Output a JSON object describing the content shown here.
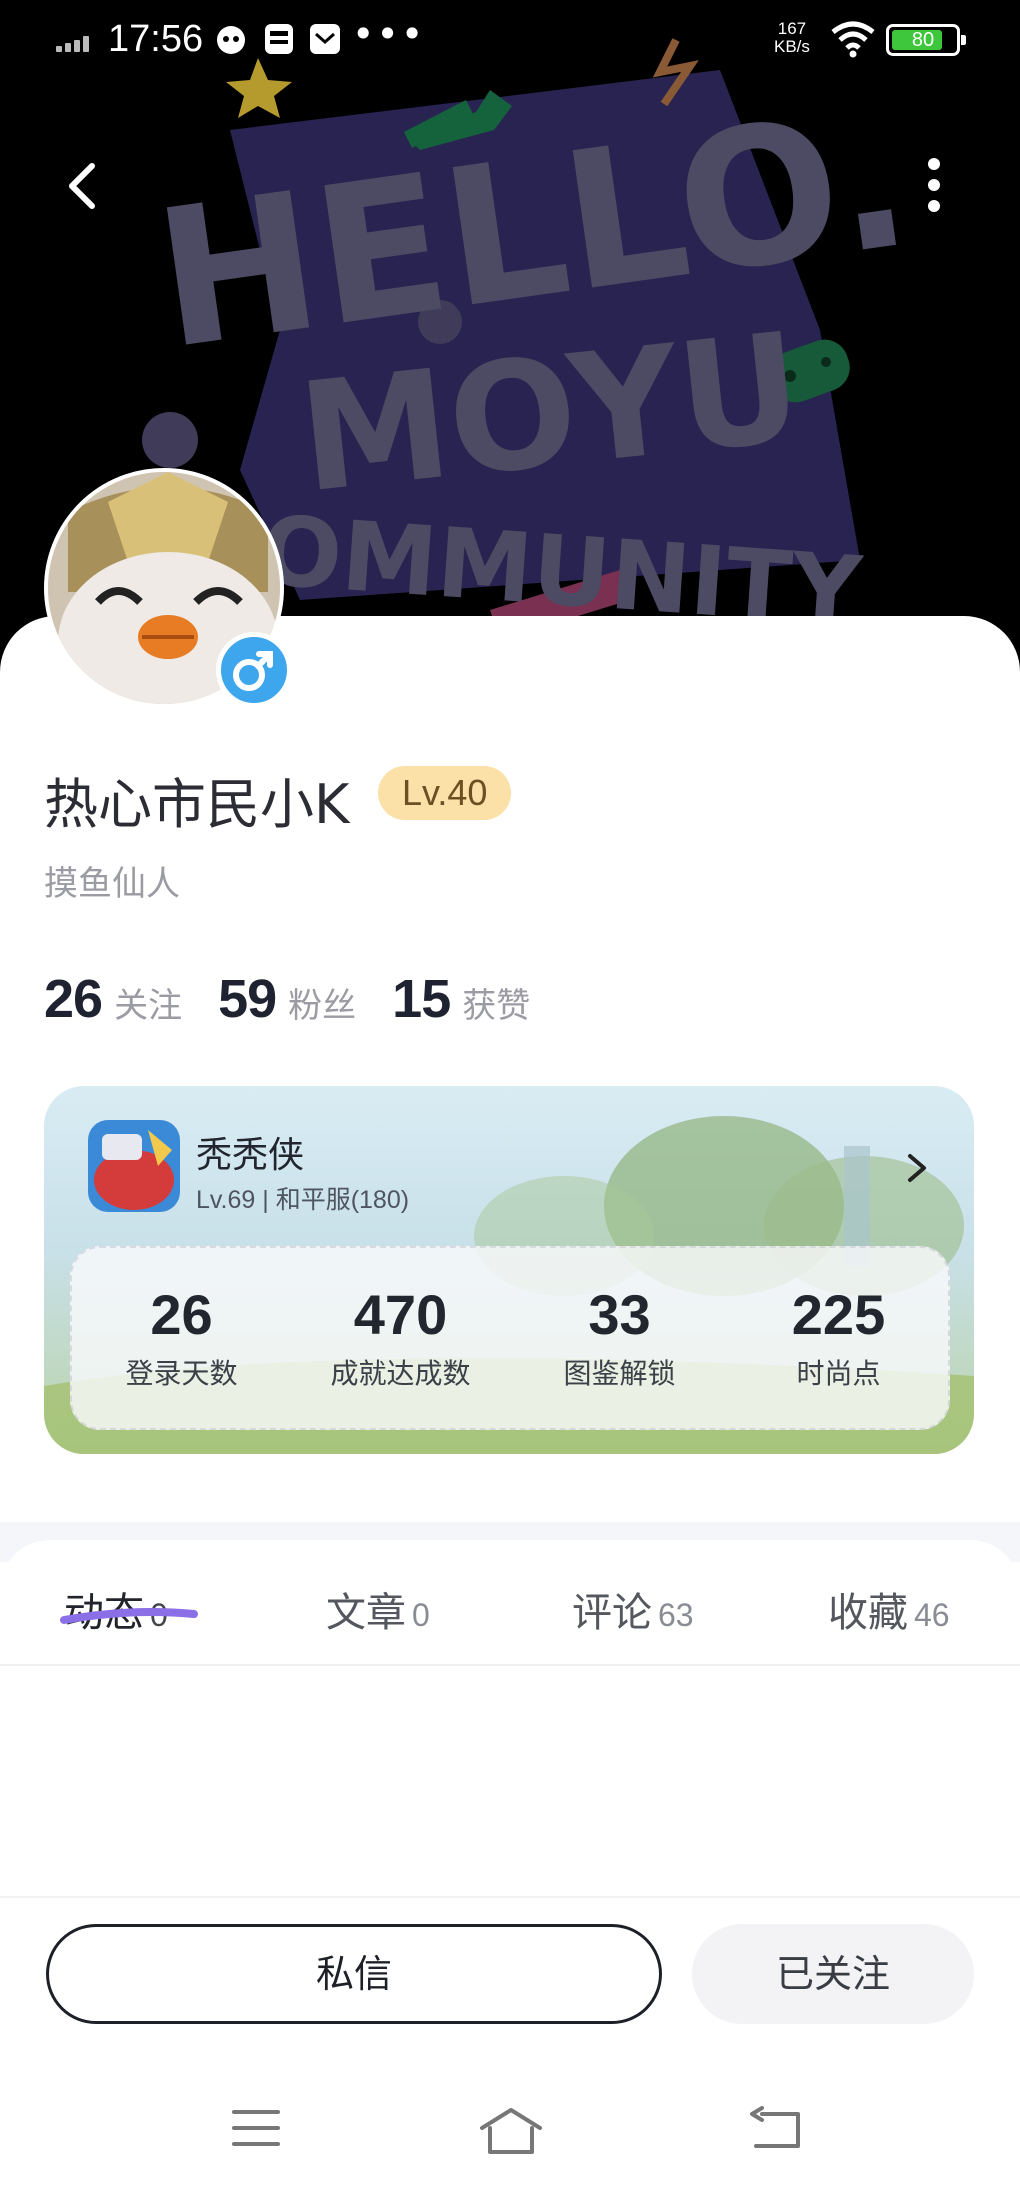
{
  "status_bar": {
    "time": "17:56",
    "net_speed_value": "167",
    "net_speed_unit": "KB/s",
    "battery": "80",
    "battery_level": 0.8,
    "icons": [
      "signal-icon",
      "cat-app-icon",
      "train-app-icon",
      "mail-app-icon",
      "more-dots-icon",
      "wifi-icon",
      "battery-icon"
    ]
  },
  "nav": {
    "back_icon": "chevron-left-icon",
    "more_icon": "vertical-dots-icon"
  },
  "banner": {
    "line1": "HELLO.",
    "line2": "MOYU",
    "line3": "COMMUNITY"
  },
  "profile": {
    "username": "热心市民小K",
    "level": "Lv.40",
    "title": "摸鱼仙人",
    "gender_icon": "male-icon",
    "stats": [
      {
        "value": "26",
        "label": "关注"
      },
      {
        "value": "59",
        "label": "粉丝"
      },
      {
        "value": "15",
        "label": "获赞"
      }
    ]
  },
  "game_card": {
    "name": "秃秃侠",
    "subtitle": "Lv.69 | 和平服(180)",
    "stats": [
      {
        "value": "26",
        "label": "登录天数"
      },
      {
        "value": "470",
        "label": "成就达成数"
      },
      {
        "value": "33",
        "label": "图鉴解锁"
      },
      {
        "value": "225",
        "label": "时尚点"
      }
    ]
  },
  "tabs": [
    {
      "label": "动态",
      "count": "0",
      "active": true
    },
    {
      "label": "文章",
      "count": "0",
      "active": false
    },
    {
      "label": "评论",
      "count": "63",
      "active": false
    },
    {
      "label": "收藏",
      "count": "46",
      "active": false
    }
  ],
  "actions": {
    "message": "私信",
    "following": "已关注"
  },
  "colors": {
    "accent_underline": "#8b6fe6",
    "level_badge_bg": "#fbe0a8",
    "gender_badge": "#3ea6ec",
    "battery_fill": "#3ec63c"
  }
}
